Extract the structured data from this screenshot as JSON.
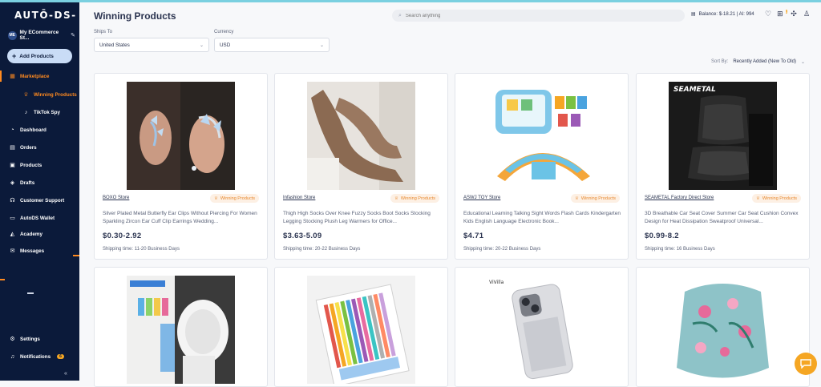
{
  "app": {
    "logo": "AUTŌ-DS-"
  },
  "sidebar": {
    "store_name": "My ECommerce St...",
    "store_initials": "ME",
    "add_products": "Add Products",
    "items": [
      {
        "label": "Marketplace"
      },
      {
        "label": "Winning Products"
      },
      {
        "label": "TikTok Spy"
      },
      {
        "label": "Dashboard"
      },
      {
        "label": "Orders"
      },
      {
        "label": "Products"
      },
      {
        "label": "Drafts"
      },
      {
        "label": "Customer Support"
      },
      {
        "label": "AutoDS Wallet"
      },
      {
        "label": "Academy"
      },
      {
        "label": "Messages"
      },
      {
        "label": "Settings"
      },
      {
        "label": "Notifications"
      }
    ],
    "notifications_count": "6"
  },
  "header": {
    "title": "Winning Products",
    "search_placeholder": "Search anything",
    "balance": "Balance: $-18.21 | AI: 994",
    "cart_badge": "1"
  },
  "filters": {
    "ships_to_label": "Ships To",
    "ships_to_value": "United States",
    "currency_label": "Currency",
    "currency_value": "USD",
    "sort_label": "Sort By:",
    "sort_value": "Recently Added (New To Old)"
  },
  "cards": [
    {
      "store": "BOXO Store",
      "badge": "Winning Products",
      "title": "Silver Plated Metal Butterfly Ear Clips Without Piercing For Women Sparkling Zircon Ear Cuff Clip Earrings Wedding...",
      "price": "$0.30-2.92",
      "shipping": "Shipping time: 11-20 Business Days"
    },
    {
      "store": "Infashion Store",
      "badge": "Winning Products",
      "title": "Thigh High Socks Over Knee Fuzzy Socks Boot Socks Stocking Legging Stocking Plush Leg Warmers for Office...",
      "price": "$3.63-5.09",
      "shipping": "Shipping time: 20-22 Business Days"
    },
    {
      "store": "ASWJ TOY Store",
      "badge": "Winning Products",
      "title": "Educational Learning Talking Sight Words Flash Cards Kindergarten Kids English Language Electronic Book...",
      "price": "$4.71",
      "shipping": "Shipping time: 20-22 Business Days"
    },
    {
      "store": "SEAMETAL Factory Direct Store",
      "badge": "Winning Products",
      "title": "3D Breathable Car Seat Cover Summer Car Seat Cushion Convex Design for Heat Dissipation Sweatproof Universal...",
      "price": "$0.99-8.2",
      "shipping": "Shipping time: 16 Business Days"
    }
  ],
  "image_texts": {
    "seametal_logo": "SEAMETAL",
    "case_brand": "ViVilla"
  }
}
